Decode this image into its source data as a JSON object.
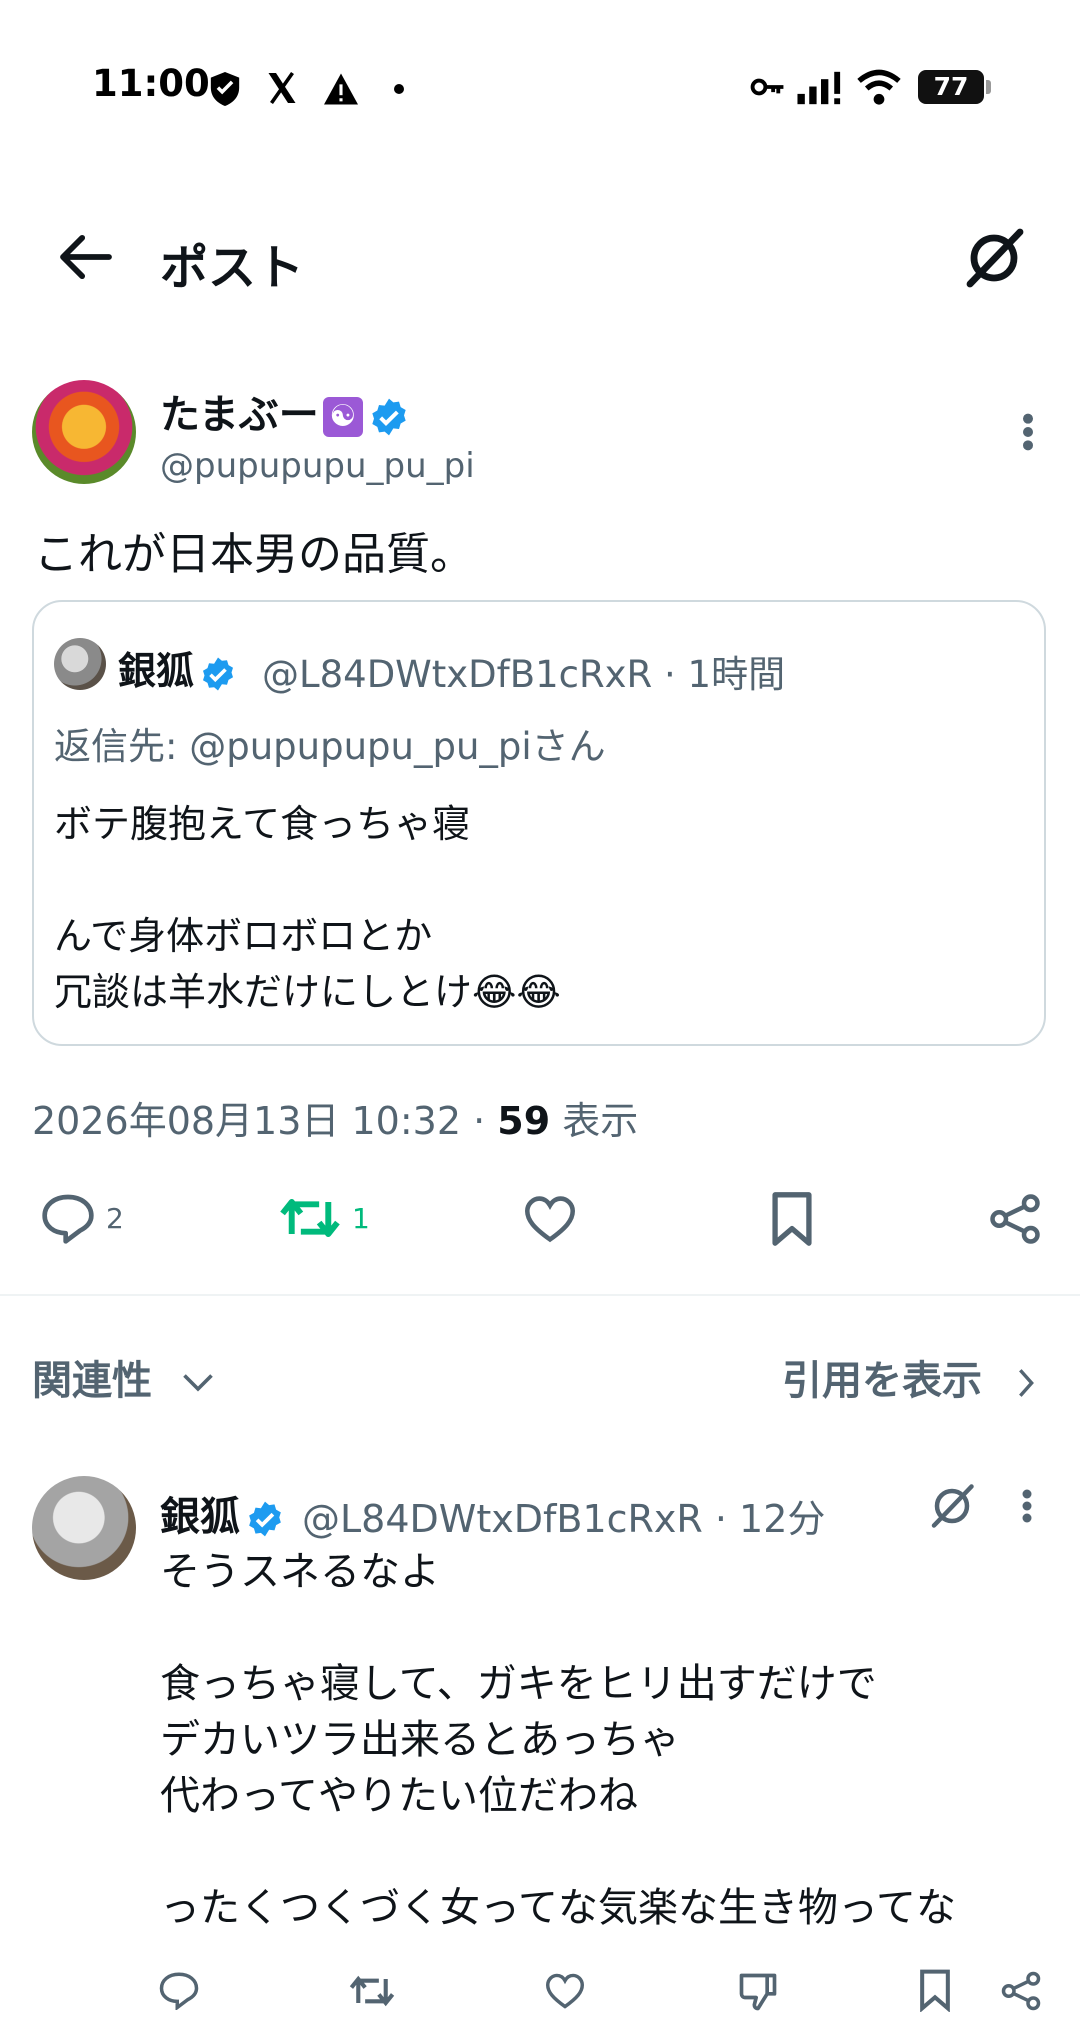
{
  "status_bar": {
    "time": "11:00",
    "battery": "77"
  },
  "header": {
    "title": "ポスト"
  },
  "post": {
    "display_name": "たまぶー",
    "emoji": "☯",
    "handle": "@pupupupu_pu_pi",
    "text": "これが日本男の品質。",
    "timestamp": "2026年08月13日 10:32",
    "views_count": "59",
    "views_label": "表示",
    "reply_count": "2",
    "repost_count": "1"
  },
  "quote": {
    "display_name": "銀狐",
    "handle_time": "@L84DWtxDfB1cRxR · 1時間",
    "reply_to": "返信先: @pupupupu_pu_piさん",
    "body": "ボテ腹抱えて食っちゃ寝\n\nんで身体ボロボロとか\n冗談は羊水だけにしとけ😂😂"
  },
  "sort": {
    "label": "関連性",
    "quotes_label": "引用を表示"
  },
  "reply": {
    "display_name": "銀狐",
    "handle_time": "@L84DWtxDfB1cRxR · 12分",
    "body": "そうスネるなよ\n\n食っちゃ寝して、ガキをヒリ出すだけで\nデカいツラ出来るとあっちゃ\n代わってやりたい位だわね\n\nったくつくづく女ってな気楽な生き物ってな"
  },
  "colors": {
    "verified": "#1d9bf0",
    "repost": "#00ba7c",
    "secondary": "#536471"
  }
}
